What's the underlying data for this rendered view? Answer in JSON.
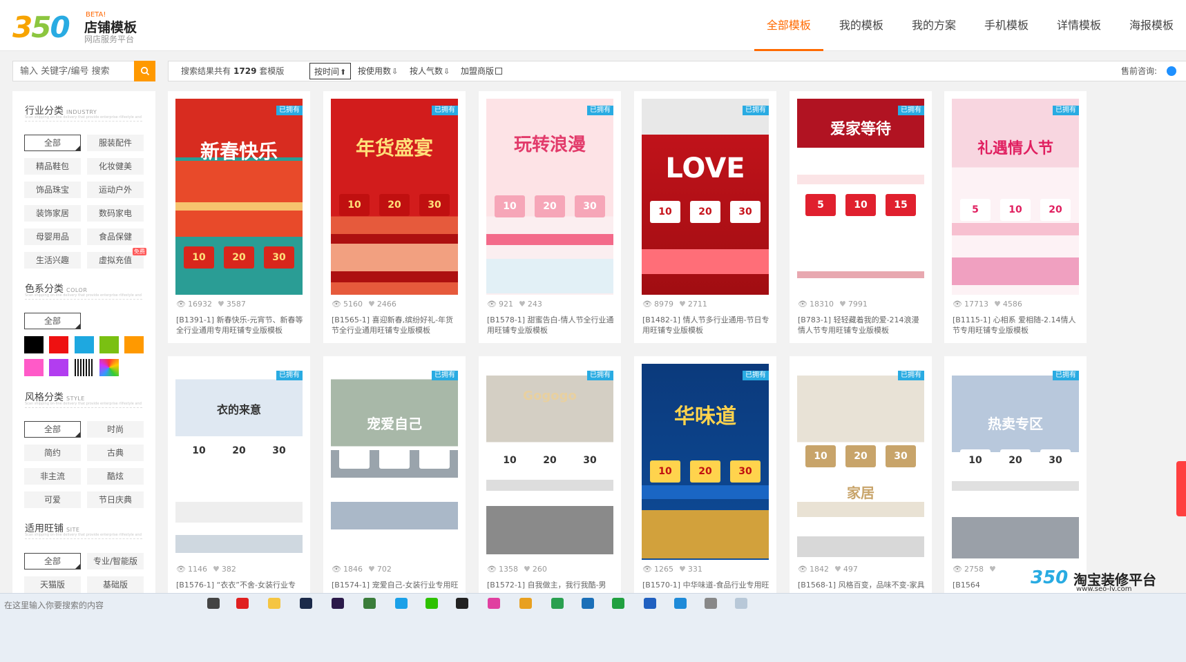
{
  "logo": {
    "mark": "350",
    "beta": "BETA!",
    "title": "店铺模板",
    "subtitle": "网店服务平台"
  },
  "nav": [
    "全部模板",
    "我的模板",
    "我的方案",
    "手机模板",
    "详情模板",
    "海报模板"
  ],
  "search": {
    "placeholder": "输入 关键字/编号 搜索"
  },
  "filter": {
    "result_prefix": "搜索结果共有",
    "result_count": "1729",
    "result_suffix": "套模版",
    "sorts": [
      {
        "label": "按时间",
        "arrow": "⬆"
      },
      {
        "label": "按使用数",
        "arrow": "⇩"
      },
      {
        "label": "按人气数",
        "arrow": "⇩"
      }
    ],
    "join_label": "加盟商版",
    "presale_label": "售前咨询:"
  },
  "sidebar": {
    "industry": {
      "title": "行业分类",
      "en": "INDUSTRY",
      "desc": "Scan shipping on-line delivery that provide enterprise\n rlifestyle and and fashion line with affordable prices on-line fashion store",
      "tags": [
        "全部",
        "服装配件",
        "精品鞋包",
        "化妆健美",
        "饰品珠宝",
        "运动户外",
        "装饰家居",
        "数码家电",
        "母婴用品",
        "食品保健",
        "生活兴趣",
        "虚拟充值"
      ],
      "free_badge": "免费"
    },
    "color": {
      "title": "色系分类",
      "en": "COLOR",
      "desc": "Scan shipping on-line delivery that provide enterprise\n rlifestyle and and fashion line with affordable prices on-line fashion store",
      "all_label": "全部",
      "swatches": [
        "#000000",
        "#ee1111",
        "#1ea8e0",
        "#7ac012",
        "#ff9900",
        "#ff5ac8",
        "#b23df0",
        "stripes",
        "rainbow"
      ]
    },
    "style": {
      "title": "风格分类",
      "en": "STYLE",
      "desc": "Scan shipping on-line delivery that provide enterprise\n rlifestyle and and fashion line with affordable prices on-line fashion store",
      "tags": [
        "全部",
        "时尚",
        "简约",
        "古典",
        "非主流",
        "酷炫",
        "可爱",
        "节日庆典"
      ]
    },
    "site": {
      "title": "适用旺铺",
      "en": "SITE",
      "desc": "Scan shipping on-line delivery that provide enterprise\n rlifestyle and and fashion line with affordable prices on-line fashion store",
      "tags": [
        "全部",
        "专业/智能版",
        "天猫版",
        "基础版"
      ]
    }
  },
  "owned_label": "已拥有",
  "cards": [
    {
      "views": "16932",
      "likes": "3587",
      "title": "[B1391-1] 新春快乐-元宵节、新春等全行业通用专用旺铺专业版模板",
      "headline": "新春快乐",
      "coupons": [
        "10",
        "20",
        "30"
      ]
    },
    {
      "views": "5160",
      "likes": "2466",
      "title": "[B1565-1] 喜迎新春,缤纷好礼-年货节全行业通用旺铺专业版模板",
      "headline": "年货盛宴",
      "coupons": [
        "10",
        "20",
        "30"
      ]
    },
    {
      "views": "921",
      "likes": "243",
      "title": "[B1578-1] 甜蜜告白-情人节全行业通用旺铺专业版模板",
      "headline": "玩转浪漫",
      "coupons": [
        "10",
        "20",
        "30"
      ]
    },
    {
      "views": "8979",
      "likes": "2711",
      "title": "[B1482-1] 情人节多行业通用-节日专用旺铺专业版模板",
      "headline": "LOVE",
      "coupons": [
        "10",
        "20",
        "30"
      ]
    },
    {
      "views": "18310",
      "likes": "7991",
      "title": "[B783-1] 轻轻藏着我的爱-214浪漫情人节专用旺铺专业版模板",
      "headline": "爱家等待",
      "coupons": [
        "5",
        "10",
        "15"
      ]
    },
    {
      "views": "17713",
      "likes": "4586",
      "title": "[B1115-1] 心相系 爱相随-2.14情人节专用旺铺专业版模板",
      "headline": "礼遇情人节",
      "coupons": [
        "5",
        "10",
        "20"
      ]
    },
    {
      "views": "1146",
      "likes": "382",
      "title": "[B1576-1] “衣衣”不舍-女装行业专",
      "headline": "衣的来意",
      "coupons": [
        "10",
        "20",
        "30"
      ]
    },
    {
      "views": "1846",
      "likes": "702",
      "title": "[B1574-1] 宠爱自己-女装行业专用旺",
      "headline": "宠爱自己",
      "coupons": [
        "",
        "",
        ""
      ]
    },
    {
      "views": "1358",
      "likes": "260",
      "title": "[B1572-1] 自我做主，我行我酷-男",
      "headline": "Gogogo",
      "coupons": [
        "10",
        "20",
        "30"
      ]
    },
    {
      "views": "1265",
      "likes": "331",
      "title": "[B1570-1] 中华味道-食品行业专用旺",
      "headline": "华味道",
      "coupons": [
        "10",
        "20",
        "30"
      ]
    },
    {
      "views": "1842",
      "likes": "497",
      "title": "[B1568-1] 风格百变，品味不变-家具",
      "headline": "家居",
      "coupons": [
        "10",
        "20",
        "30"
      ]
    },
    {
      "views": "2758",
      "likes": "",
      "title": "[B1564",
      "headline": "热卖专区",
      "coupons": [
        "10",
        "20",
        "30"
      ]
    }
  ],
  "taskbar": {
    "hint": "在这里输入你要搜索的内容"
  },
  "watermark": {
    "logo": "350",
    "title": "淘宝装修平台",
    "url": "www.seo-lv.com"
  }
}
